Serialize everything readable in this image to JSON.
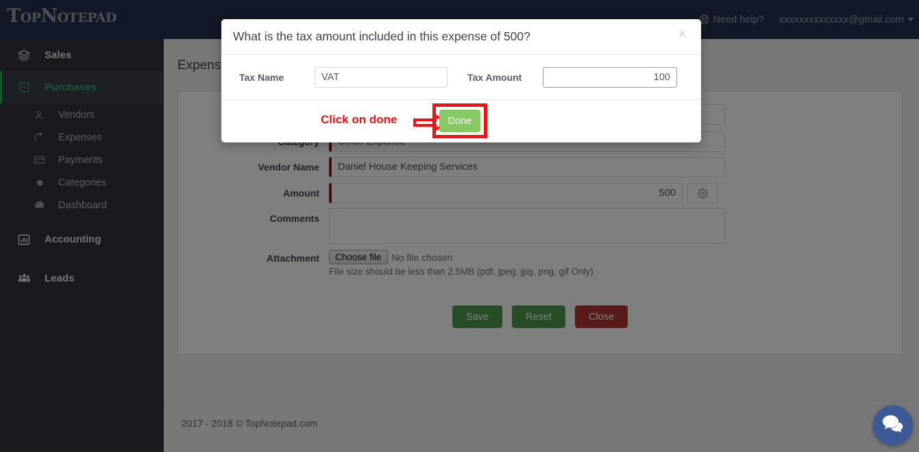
{
  "topbar": {
    "logo": "TopNotepad",
    "help_label": "Need help?",
    "help_icon": "life-ring-icon",
    "user_email": "xxxxxxxxxxxxxx@gmail.com",
    "caret_icon": "caret-down-icon",
    "bg_color": "#22304f"
  },
  "sidebar": {
    "bg_color": "#31353d",
    "active_color": "#2eaf6d",
    "items": [
      {
        "label": "Sales",
        "icon": "layers-icon",
        "level": "top",
        "active": false
      },
      {
        "label": "Purchases",
        "icon": "minus-box-icon",
        "level": "top",
        "active": true
      },
      {
        "label": "Vendors",
        "icon": "user-icon",
        "level": "sub",
        "active": false
      },
      {
        "label": "Expenses",
        "icon": "share-icon",
        "level": "sub",
        "active": false
      },
      {
        "label": "Payments",
        "icon": "card-icon",
        "level": "sub",
        "active": false
      },
      {
        "label": "Categories",
        "icon": "gear-icon",
        "level": "sub",
        "active": false
      },
      {
        "label": "Dashboard",
        "icon": "gauge-icon",
        "level": "sub",
        "active": false
      },
      {
        "label": "Accounting",
        "icon": "chart-bar-icon",
        "level": "top",
        "active": false
      },
      {
        "label": "Leads",
        "icon": "users-icon",
        "level": "top",
        "active": false
      }
    ]
  },
  "page": {
    "title": "Expense",
    "form": {
      "category": {
        "label": "Category",
        "value": "Office Expense"
      },
      "vendor": {
        "label": "Vendor Name",
        "value": "Daniel House Keeping Services"
      },
      "amount": {
        "label": "Amount",
        "value": "500",
        "gear_icon": "gear-icon"
      },
      "comments": {
        "label": "Comments",
        "value": ""
      },
      "attachment": {
        "label": "Attachment",
        "choose_label": "Choose file",
        "no_file_text": "No file chosen",
        "hint": "File size should be less than 2.5MB (pdf, jpeg, jpg, png, gif Only)"
      }
    },
    "buttons": {
      "save": "Save",
      "reset": "Reset",
      "close": "Close",
      "green_color": "#4e9a4e",
      "red_color": "#b33434"
    },
    "footer_text": "2017 - 2018 © TopNotepad.com"
  },
  "modal": {
    "title": "What is the tax amount included in this expense of 500?",
    "close_icon": "close-icon",
    "tax_name": {
      "label": "Tax Name",
      "value": "VAT",
      "placeholder": ""
    },
    "tax_amount": {
      "label": "Tax Amount",
      "value": "100",
      "placeholder": ""
    },
    "done_label": "Done",
    "annotation": {
      "text": "Click on done",
      "color": "#f01414",
      "arrow_icon": "right-arrow-icon"
    }
  },
  "chat": {
    "icon": "chat-bubbles-icon",
    "color": "#3d5a98"
  }
}
